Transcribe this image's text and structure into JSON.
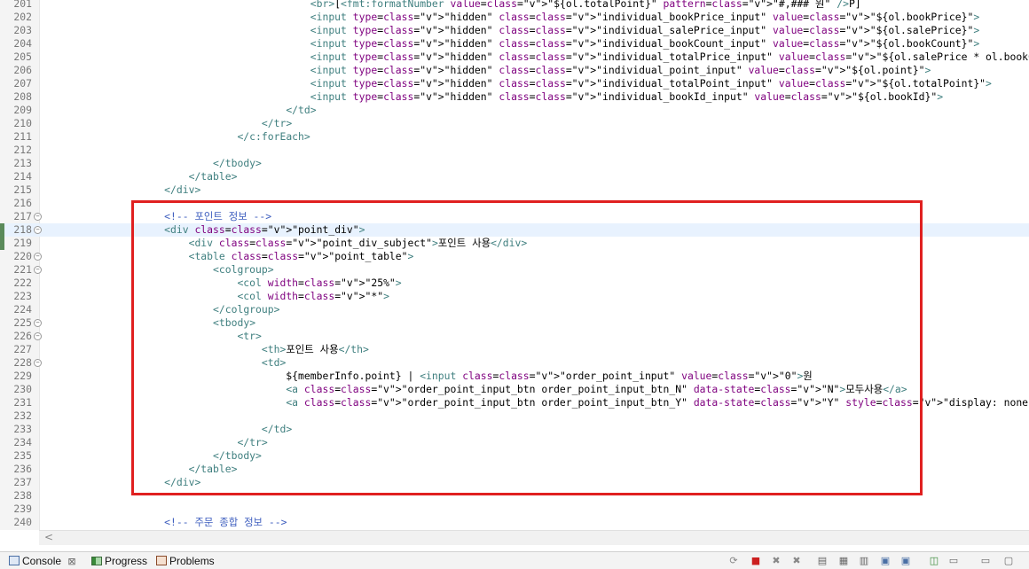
{
  "editor": {
    "lines": [
      {
        "n": "201",
        "t": "                                            <br>[<fmt:formatNumber value=\"${ol.totalPoint}\" pattern=\"#,### 원\" />P]"
      },
      {
        "n": "202",
        "t": "                                            <input type=\"hidden\" class=\"individual_bookPrice_input\" value=\"${ol.bookPrice}\">"
      },
      {
        "n": "203",
        "t": "                                            <input type=\"hidden\" class=\"individual_salePrice_input\" value=\"${ol.salePrice}\">"
      },
      {
        "n": "204",
        "t": "                                            <input type=\"hidden\" class=\"individual_bookCount_input\" value=\"${ol.bookCount}\">"
      },
      {
        "n": "205",
        "t": "                                            <input type=\"hidden\" class=\"individual_totalPrice_input\" value=\"${ol.salePrice * ol.bookCount}\">"
      },
      {
        "n": "206",
        "t": "                                            <input type=\"hidden\" class=\"individual_point_input\" value=\"${ol.point}\">"
      },
      {
        "n": "207",
        "t": "                                            <input type=\"hidden\" class=\"individual_totalPoint_input\" value=\"${ol.totalPoint}\">"
      },
      {
        "n": "208",
        "t": "                                            <input type=\"hidden\" class=\"individual_bookId_input\" value=\"${ol.bookId}\">"
      },
      {
        "n": "209",
        "t": "                                        </td>"
      },
      {
        "n": "210",
        "t": "                                    </tr>"
      },
      {
        "n": "211",
        "t": "                                </c:forEach>"
      },
      {
        "n": "212",
        "t": ""
      },
      {
        "n": "213",
        "t": "                            </tbody>"
      },
      {
        "n": "214",
        "t": "                        </table>"
      },
      {
        "n": "215",
        "t": "                    </div>"
      },
      {
        "n": "216",
        "t": ""
      },
      {
        "n": "217",
        "t": "                    <!-- 포인트 정보 -->",
        "fold": true
      },
      {
        "n": "218",
        "t": "                    <div class=\"point_div\">",
        "fold": true,
        "cur": true,
        "mark": true
      },
      {
        "n": "219",
        "t": "                        <div class=\"point_div_subject\">포인트 사용</div>",
        "mark": true
      },
      {
        "n": "220",
        "t": "                        <table class=\"point_table\">",
        "fold": true
      },
      {
        "n": "221",
        "t": "                            <colgroup>",
        "fold": true
      },
      {
        "n": "222",
        "t": "                                <col width=\"25%\">"
      },
      {
        "n": "223",
        "t": "                                <col width=\"*\">"
      },
      {
        "n": "224",
        "t": "                            </colgroup>"
      },
      {
        "n": "225",
        "t": "                            <tbody>",
        "fold": true
      },
      {
        "n": "226",
        "t": "                                <tr>",
        "fold": true
      },
      {
        "n": "227",
        "t": "                                    <th>포인트 사용</th>"
      },
      {
        "n": "228",
        "t": "                                    <td>",
        "fold": true
      },
      {
        "n": "229",
        "t": "                                        ${memberInfo.point} | <input class=\"order_point_input\" value=\"0\">원"
      },
      {
        "n": "230",
        "t": "                                        <a class=\"order_point_input_btn order_point_input_btn_N\" data-state=\"N\">모두사용</a>"
      },
      {
        "n": "231",
        "t": "                                        <a class=\"order_point_input_btn order_point_input_btn_Y\" data-state=\"Y\" style=\"display: none;\">사용취소</a>"
      },
      {
        "n": "232",
        "t": ""
      },
      {
        "n": "233",
        "t": "                                    </td>"
      },
      {
        "n": "234",
        "t": "                                </tr>"
      },
      {
        "n": "235",
        "t": "                            </tbody>"
      },
      {
        "n": "236",
        "t": "                        </table>"
      },
      {
        "n": "237",
        "t": "                    </div>"
      },
      {
        "n": "238",
        "t": ""
      },
      {
        "n": "239",
        "t": ""
      },
      {
        "n": "240",
        "t": "                    <!-- 주문 종합 정보 -->"
      }
    ]
  },
  "bottom_tabs": [
    {
      "label": "Console",
      "name": "tab-console",
      "icon": "console-icon",
      "close": "⊠"
    },
    {
      "label": "Progress",
      "name": "tab-progress",
      "icon": "progress-icon"
    },
    {
      "label": "Problems",
      "name": "tab-problems",
      "icon": "problems-icon"
    }
  ],
  "toolbar_icons": [
    "link-icon",
    "terminate-icon",
    "remove-launch-icon",
    "remove-all-icon",
    "clear-console-icon",
    "scroll-lock-icon",
    "word-wrap-icon",
    "show-console-icon",
    "pin-console-icon",
    "open-console-icon",
    "display-console-icon",
    "minimize-icon",
    "maximize-icon"
  ],
  "colors": {
    "highlight_border": "#e02020",
    "tag": "#3f7f7f",
    "attr": "#7f007f",
    "value": "#2a00ff",
    "comment": "#3f5fbf"
  }
}
